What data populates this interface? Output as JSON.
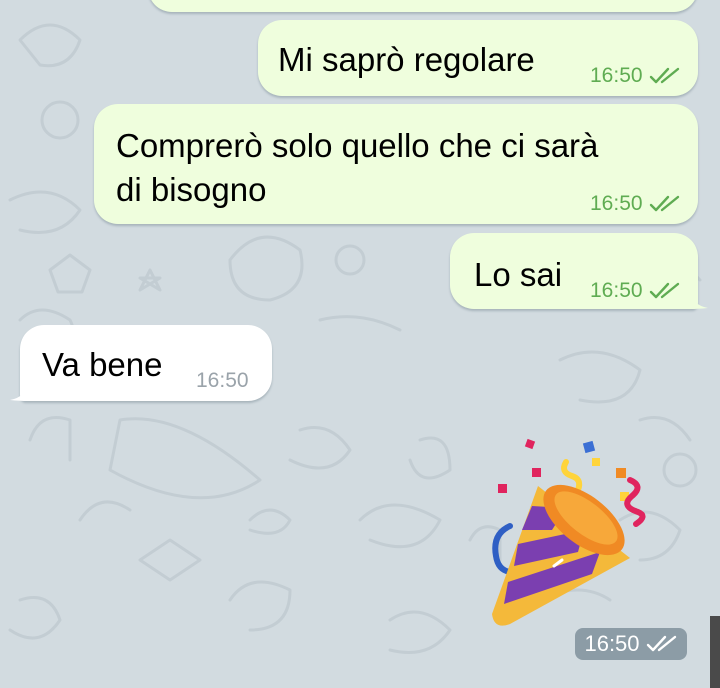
{
  "chat": {
    "messages": [
      {
        "direction": "outgoing",
        "text": "Mi saprò regolare",
        "time": "16:50",
        "status_icon": "double-check-icon"
      },
      {
        "direction": "outgoing",
        "text_line1": "Comprerò solo quello che ci sarà",
        "text_line2": "di bisogno",
        "time": "16:50",
        "status_icon": "double-check-icon"
      },
      {
        "direction": "outgoing",
        "text": "Lo sai",
        "time": "16:50",
        "status_icon": "double-check-icon"
      },
      {
        "direction": "incoming",
        "text": "Va bene",
        "time": "16:50"
      }
    ],
    "sticker": {
      "name": "party-popper-sticker",
      "time": "16:50",
      "status_icon": "double-check-icon"
    }
  },
  "colors": {
    "background": "#d2dbe0",
    "outgoing_bubble": "#effedd",
    "incoming_bubble": "#ffffff",
    "outgoing_meta": "#5fac52",
    "incoming_meta": "#9aa3aa"
  }
}
